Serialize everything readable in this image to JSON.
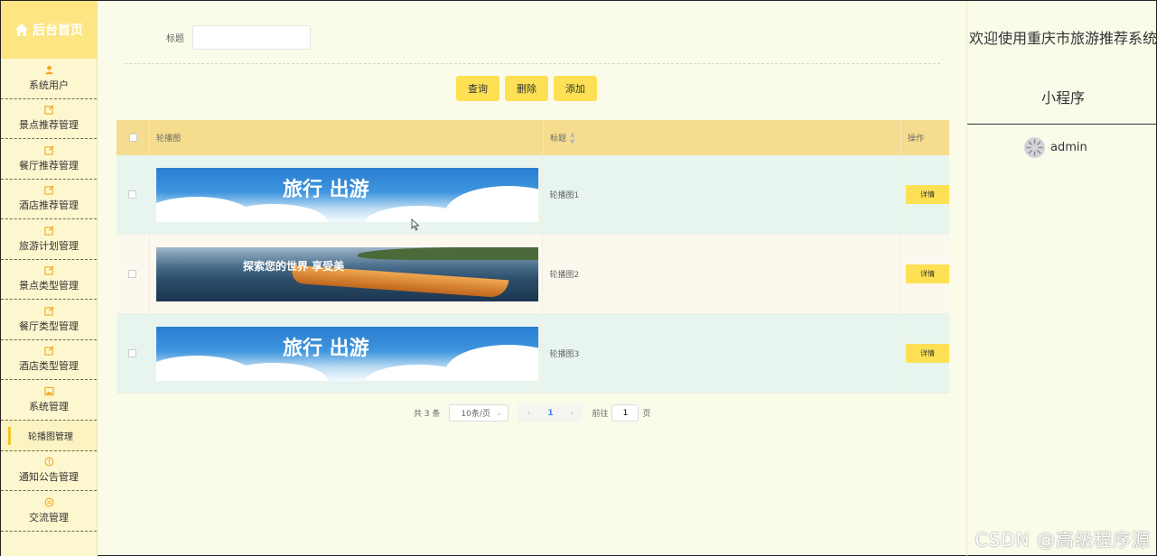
{
  "sidebar": {
    "home_label": "后台首页",
    "items": [
      {
        "label": "系统用户",
        "icon": "user-icon"
      },
      {
        "label": "景点推荐管理",
        "icon": "edit-icon"
      },
      {
        "label": "餐厅推荐管理",
        "icon": "edit-icon"
      },
      {
        "label": "酒店推荐管理",
        "icon": "edit-icon"
      },
      {
        "label": "旅游计划管理",
        "icon": "edit-icon"
      },
      {
        "label": "景点类型管理",
        "icon": "edit-icon"
      },
      {
        "label": "餐厅类型管理",
        "icon": "edit-icon"
      },
      {
        "label": "酒店类型管理",
        "icon": "edit-icon"
      },
      {
        "label": "系统管理",
        "icon": "image-icon"
      }
    ],
    "sub_item": "轮播图管理",
    "items_after": [
      {
        "label": "通知公告管理",
        "icon": "info-icon"
      },
      {
        "label": "交流管理",
        "icon": "chat-icon"
      }
    ],
    "accent_color": "#f0c330"
  },
  "search": {
    "label": "标题",
    "value": "",
    "placeholder": ""
  },
  "toolbar": {
    "query_label": "查询",
    "delete_label": "删除",
    "add_label": "添加"
  },
  "table": {
    "headers": {
      "image": "轮播图",
      "title": "标题",
      "op": "操作"
    },
    "rows": [
      {
        "title": "轮播图1",
        "banner_text": "旅行  出游",
        "action": "详情"
      },
      {
        "title": "轮播图2",
        "banner_text": "探索您的世界  享受美",
        "action": "详情"
      },
      {
        "title": "轮播图3",
        "banner_text": "旅行  出游",
        "action": "详情"
      }
    ]
  },
  "pager": {
    "total": "共 3 条",
    "page_size": "10条/页",
    "current": "1",
    "goto_prefix": "前往",
    "goto_value": "1",
    "goto_suffix": "页"
  },
  "header": {
    "welcome_line1": "欢迎使用重庆市旅游推荐系统",
    "welcome_line2": "小程序",
    "username": "admin"
  },
  "watermark": "CSDN @高级程序源",
  "colors": {
    "button": "#fde054",
    "table_header": "#f5dc8e",
    "row_odd": "#e7f5ee",
    "row_even": "#fcf8ee",
    "background": "#fbfbea"
  }
}
